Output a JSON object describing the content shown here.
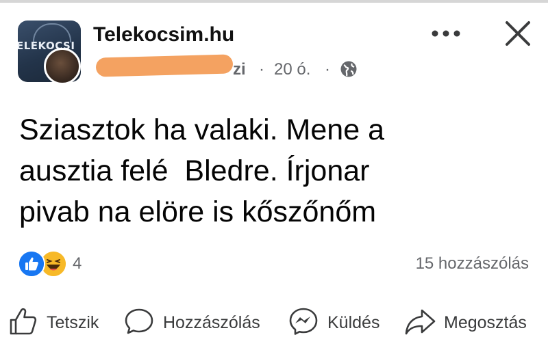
{
  "header": {
    "group_name": "Telekocsim.hu",
    "group_logo_text": "ELEKOCSI",
    "author_visible_tail": "zi",
    "meta_separator": "·",
    "time": "20 ó.",
    "privacy_icon": "globe-icon",
    "more_icon": "more-horizontal-icon",
    "close_icon": "close-icon"
  },
  "post": {
    "lines": [
      "Sziasztok ha valaki. Mene a",
      "ausztia felé  Bledre. Írjonar",
      "pivab na elöre is kőszőnőm"
    ]
  },
  "reactions": {
    "icons": [
      "like-icon",
      "haha-icon"
    ],
    "count": "4",
    "comments_label": "15 hozzászólás"
  },
  "actions": {
    "like": "Tetszik",
    "comment": "Hozzászólás",
    "send": "Küldés",
    "share": "Megosztás"
  },
  "colors": {
    "accent_blue": "#1877f2",
    "secondary_text": "#65676b",
    "redaction": "#f4a261",
    "haha_yellow": "#f7b928"
  }
}
